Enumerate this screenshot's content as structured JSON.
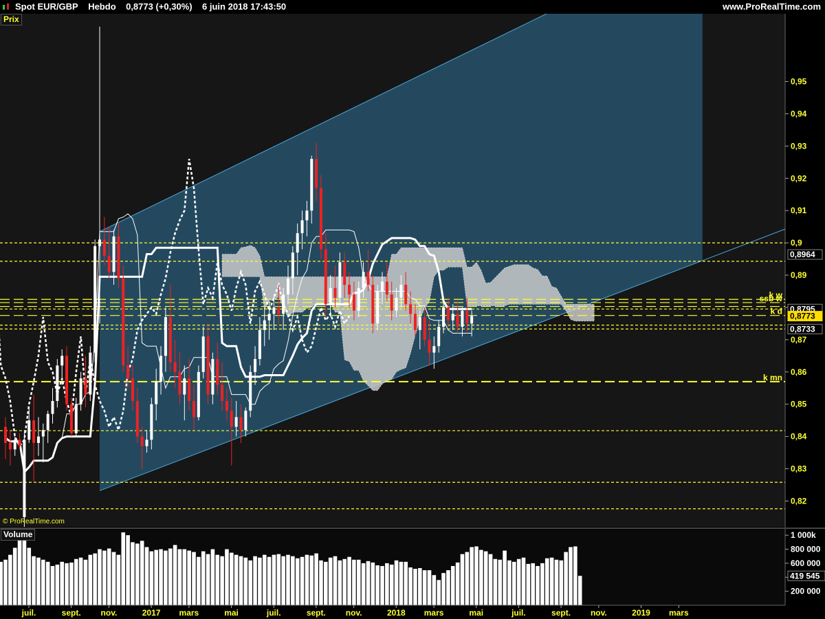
{
  "header": {
    "instrument": "Spot EUR/GBP",
    "period": "Hebdo",
    "last": "0,8773 (+0,30%)",
    "datetime": "6 juin 2018 17:43:50",
    "site": "www.ProRealTime.com"
  },
  "panels": {
    "price_label": "Prix",
    "volume_label": "Volume",
    "watermark": "© ProRealTime.com"
  },
  "colors": {
    "background": "#000000",
    "plot_bg": "#161616",
    "channel_fill": "#2a5b78",
    "channel_line": "#4aa8d8",
    "bull": "#ffffff",
    "bear": "#ee2222",
    "level_line": "#ffff33",
    "cloud": "#d0d0d0",
    "tick_text": "#ffff33"
  },
  "chart_data": {
    "type": "candlestick",
    "title": "Spot EUR/GBP",
    "y_axis": {
      "ylim": [
        0.812,
        0.971
      ],
      "ticks": [
        0.82,
        0.83,
        0.84,
        0.85,
        0.86,
        0.87,
        0.88,
        0.89,
        0.9,
        0.91,
        0.92,
        0.93,
        0.94,
        0.95
      ],
      "tick_labels": [
        "0,82",
        "0,83",
        "0,84",
        "0,85",
        "0,86",
        "0,87",
        "0,88",
        "0,89",
        "0,9",
        "0,91",
        "0,92",
        "0,93",
        "0,94",
        "0,95"
      ]
    },
    "x_axis": {
      "labels": [
        "juil.",
        "sept.",
        "nov.",
        "2017",
        "mars",
        "mai",
        "juil.",
        "sept.",
        "nov.",
        "2018",
        "mars",
        "mai",
        "juil.",
        "sept.",
        "nov.",
        "2019",
        "mars"
      ],
      "label_weeks": [
        0,
        9,
        17,
        26,
        34,
        43,
        52,
        61,
        69,
        78,
        86,
        95,
        104,
        113,
        121,
        130,
        138
      ]
    },
    "price_tags": [
      {
        "label": "0,8964",
        "value": 0.8964,
        "highlight": false
      },
      {
        "label": "0,8795",
        "value": 0.8795,
        "highlight": false
      },
      {
        "label": "0,8773",
        "value": 0.8773,
        "highlight": true
      },
      {
        "label": "0,8733",
        "value": 0.8733,
        "highlight": false
      }
    ],
    "levels": [
      {
        "value": 0.9,
        "name": "",
        "style": "dotted"
      },
      {
        "value": 0.8943,
        "name": "",
        "style": "dotted"
      },
      {
        "value": 0.8825,
        "name": "k w",
        "style": "dashed"
      },
      {
        "value": 0.8815,
        "name": "ssb w",
        "style": "dashed"
      },
      {
        "value": 0.8803,
        "name": "",
        "style": "dashed"
      },
      {
        "value": 0.8795,
        "name": "",
        "style": "dotted"
      },
      {
        "value": 0.8775,
        "name": "k d",
        "style": "dashed"
      },
      {
        "value": 0.8745,
        "name": "",
        "style": "dotted"
      },
      {
        "value": 0.8733,
        "name": "",
        "style": "dotted"
      },
      {
        "value": 0.857,
        "name": "k mn",
        "style": "dashed"
      },
      {
        "value": 0.8418,
        "name": "",
        "style": "dotted"
      },
      {
        "value": 0.8258,
        "name": "",
        "style": "dotted"
      },
      {
        "value": 0.8176,
        "name": "",
        "style": "dotted"
      }
    ],
    "channel": {
      "upper": [
        [
          20,
          0.9035
        ],
        [
          124,
          0.9775
        ]
      ],
      "lower": [
        [
          20,
          0.8232
        ],
        [
          148,
          0.8945
        ]
      ],
      "end_week": 148
    },
    "candles": [
      {
        "o": 0.843,
        "h": 0.846,
        "l": 0.833,
        "c": 0.838
      },
      {
        "o": 0.838,
        "h": 0.842,
        "l": 0.831,
        "c": 0.836
      },
      {
        "o": 0.836,
        "h": 0.84,
        "l": 0.834,
        "c": 0.839
      },
      {
        "o": 0.839,
        "h": 0.841,
        "l": 0.836,
        "c": 0.837
      },
      {
        "o": 0.815,
        "h": 0.842,
        "l": 0.812,
        "c": 0.839
      },
      {
        "o": 0.839,
        "h": 0.849,
        "l": 0.838,
        "c": 0.845
      },
      {
        "o": 0.845,
        "h": 0.853,
        "l": 0.826,
        "c": 0.838
      },
      {
        "o": 0.838,
        "h": 0.846,
        "l": 0.834,
        "c": 0.84
      },
      {
        "o": 0.84,
        "h": 0.844,
        "l": 0.832,
        "c": 0.842
      },
      {
        "o": 0.842,
        "h": 0.848,
        "l": 0.838,
        "c": 0.847
      },
      {
        "o": 0.847,
        "h": 0.855,
        "l": 0.844,
        "c": 0.851
      },
      {
        "o": 0.851,
        "h": 0.864,
        "l": 0.849,
        "c": 0.862
      },
      {
        "o": 0.862,
        "h": 0.867,
        "l": 0.856,
        "c": 0.865
      },
      {
        "o": 0.865,
        "h": 0.868,
        "l": 0.848,
        "c": 0.85
      },
      {
        "o": 0.85,
        "h": 0.852,
        "l": 0.84,
        "c": 0.841
      },
      {
        "o": 0.841,
        "h": 0.852,
        "l": 0.84,
        "c": 0.85
      },
      {
        "o": 0.85,
        "h": 0.86,
        "l": 0.848,
        "c": 0.858
      },
      {
        "o": 0.858,
        "h": 0.865,
        "l": 0.849,
        "c": 0.853
      },
      {
        "o": 0.853,
        "h": 0.868,
        "l": 0.851,
        "c": 0.866
      },
      {
        "o": 0.866,
        "h": 0.901,
        "l": 0.863,
        "c": 0.899
      },
      {
        "o": 0.899,
        "h": 0.967,
        "l": 0.875,
        "c": 0.901
      },
      {
        "o": 0.901,
        "h": 0.908,
        "l": 0.893,
        "c": 0.896
      },
      {
        "o": 0.896,
        "h": 0.905,
        "l": 0.889,
        "c": 0.891
      },
      {
        "o": 0.891,
        "h": 0.904,
        "l": 0.887,
        "c": 0.902
      },
      {
        "o": 0.902,
        "h": 0.906,
        "l": 0.886,
        "c": 0.889
      },
      {
        "o": 0.889,
        "h": 0.893,
        "l": 0.86,
        "c": 0.862
      },
      {
        "o": 0.862,
        "h": 0.868,
        "l": 0.855,
        "c": 0.858
      },
      {
        "o": 0.858,
        "h": 0.862,
        "l": 0.848,
        "c": 0.851
      },
      {
        "o": 0.851,
        "h": 0.855,
        "l": 0.838,
        "c": 0.84
      },
      {
        "o": 0.84,
        "h": 0.843,
        "l": 0.83,
        "c": 0.837
      },
      {
        "o": 0.837,
        "h": 0.842,
        "l": 0.835,
        "c": 0.839
      },
      {
        "o": 0.839,
        "h": 0.852,
        "l": 0.836,
        "c": 0.85
      },
      {
        "o": 0.85,
        "h": 0.861,
        "l": 0.845,
        "c": 0.857
      },
      {
        "o": 0.857,
        "h": 0.868,
        "l": 0.853,
        "c": 0.865
      },
      {
        "o": 0.865,
        "h": 0.88,
        "l": 0.86,
        "c": 0.877
      },
      {
        "o": 0.877,
        "h": 0.887,
        "l": 0.86,
        "c": 0.863
      },
      {
        "o": 0.863,
        "h": 0.87,
        "l": 0.855,
        "c": 0.86
      },
      {
        "o": 0.86,
        "h": 0.866,
        "l": 0.85,
        "c": 0.853
      },
      {
        "o": 0.853,
        "h": 0.862,
        "l": 0.845,
        "c": 0.858
      },
      {
        "o": 0.858,
        "h": 0.864,
        "l": 0.848,
        "c": 0.851
      },
      {
        "o": 0.851,
        "h": 0.856,
        "l": 0.842,
        "c": 0.846
      },
      {
        "o": 0.846,
        "h": 0.862,
        "l": 0.845,
        "c": 0.86
      },
      {
        "o": 0.86,
        "h": 0.874,
        "l": 0.858,
        "c": 0.871
      },
      {
        "o": 0.871,
        "h": 0.875,
        "l": 0.85,
        "c": 0.853
      },
      {
        "o": 0.853,
        "h": 0.866,
        "l": 0.85,
        "c": 0.864
      },
      {
        "o": 0.864,
        "h": 0.869,
        "l": 0.853,
        "c": 0.856
      },
      {
        "o": 0.856,
        "h": 0.863,
        "l": 0.848,
        "c": 0.851
      },
      {
        "o": 0.851,
        "h": 0.855,
        "l": 0.845,
        "c": 0.848
      },
      {
        "o": 0.848,
        "h": 0.852,
        "l": 0.831,
        "c": 0.843
      },
      {
        "o": 0.843,
        "h": 0.851,
        "l": 0.84,
        "c": 0.846
      },
      {
        "o": 0.846,
        "h": 0.85,
        "l": 0.838,
        "c": 0.842
      },
      {
        "o": 0.842,
        "h": 0.849,
        "l": 0.84,
        "c": 0.848
      },
      {
        "o": 0.848,
        "h": 0.862,
        "l": 0.846,
        "c": 0.86
      },
      {
        "o": 0.86,
        "h": 0.868,
        "l": 0.856,
        "c": 0.864
      },
      {
        "o": 0.864,
        "h": 0.877,
        "l": 0.862,
        "c": 0.873
      },
      {
        "o": 0.873,
        "h": 0.88,
        "l": 0.868,
        "c": 0.876
      },
      {
        "o": 0.876,
        "h": 0.882,
        "l": 0.87,
        "c": 0.878
      },
      {
        "o": 0.878,
        "h": 0.884,
        "l": 0.873,
        "c": 0.88
      },
      {
        "o": 0.88,
        "h": 0.887,
        "l": 0.875,
        "c": 0.878
      },
      {
        "o": 0.878,
        "h": 0.886,
        "l": 0.873,
        "c": 0.884
      },
      {
        "o": 0.884,
        "h": 0.893,
        "l": 0.881,
        "c": 0.889
      },
      {
        "o": 0.889,
        "h": 0.899,
        "l": 0.884,
        "c": 0.897
      },
      {
        "o": 0.897,
        "h": 0.906,
        "l": 0.89,
        "c": 0.903
      },
      {
        "o": 0.903,
        "h": 0.91,
        "l": 0.898,
        "c": 0.907
      },
      {
        "o": 0.907,
        "h": 0.913,
        "l": 0.902,
        "c": 0.91
      },
      {
        "o": 0.91,
        "h": 0.927,
        "l": 0.906,
        "c": 0.926
      },
      {
        "o": 0.926,
        "h": 0.931,
        "l": 0.913,
        "c": 0.917
      },
      {
        "o": 0.917,
        "h": 0.921,
        "l": 0.895,
        "c": 0.898
      },
      {
        "o": 0.898,
        "h": 0.903,
        "l": 0.877,
        "c": 0.881
      },
      {
        "o": 0.881,
        "h": 0.89,
        "l": 0.877,
        "c": 0.886
      },
      {
        "o": 0.886,
        "h": 0.893,
        "l": 0.88,
        "c": 0.883
      },
      {
        "o": 0.883,
        "h": 0.897,
        "l": 0.881,
        "c": 0.894
      },
      {
        "o": 0.894,
        "h": 0.897,
        "l": 0.883,
        "c": 0.887
      },
      {
        "o": 0.887,
        "h": 0.891,
        "l": 0.88,
        "c": 0.884
      },
      {
        "o": 0.884,
        "h": 0.888,
        "l": 0.876,
        "c": 0.879
      },
      {
        "o": 0.879,
        "h": 0.888,
        "l": 0.877,
        "c": 0.886
      },
      {
        "o": 0.886,
        "h": 0.894,
        "l": 0.883,
        "c": 0.891
      },
      {
        "o": 0.891,
        "h": 0.898,
        "l": 0.885,
        "c": 0.887
      },
      {
        "o": 0.887,
        "h": 0.89,
        "l": 0.872,
        "c": 0.875
      },
      {
        "o": 0.875,
        "h": 0.887,
        "l": 0.873,
        "c": 0.885
      },
      {
        "o": 0.885,
        "h": 0.891,
        "l": 0.881,
        "c": 0.888
      },
      {
        "o": 0.888,
        "h": 0.894,
        "l": 0.882,
        "c": 0.884
      },
      {
        "o": 0.884,
        "h": 0.888,
        "l": 0.876,
        "c": 0.879
      },
      {
        "o": 0.879,
        "h": 0.886,
        "l": 0.877,
        "c": 0.883
      },
      {
        "o": 0.883,
        "h": 0.89,
        "l": 0.88,
        "c": 0.887
      },
      {
        "o": 0.887,
        "h": 0.891,
        "l": 0.879,
        "c": 0.881
      },
      {
        "o": 0.881,
        "h": 0.885,
        "l": 0.875,
        "c": 0.878
      },
      {
        "o": 0.878,
        "h": 0.881,
        "l": 0.871,
        "c": 0.873
      },
      {
        "o": 0.873,
        "h": 0.879,
        "l": 0.867,
        "c": 0.877
      },
      {
        "o": 0.877,
        "h": 0.88,
        "l": 0.868,
        "c": 0.87
      },
      {
        "o": 0.87,
        "h": 0.876,
        "l": 0.862,
        "c": 0.866
      },
      {
        "o": 0.866,
        "h": 0.871,
        "l": 0.861,
        "c": 0.868
      },
      {
        "o": 0.868,
        "h": 0.876,
        "l": 0.866,
        "c": 0.874
      },
      {
        "o": 0.874,
        "h": 0.882,
        "l": 0.872,
        "c": 0.88
      },
      {
        "o": 0.88,
        "h": 0.883,
        "l": 0.874,
        "c": 0.876
      },
      {
        "o": 0.876,
        "h": 0.881,
        "l": 0.873,
        "c": 0.878
      },
      {
        "o": 0.878,
        "h": 0.882,
        "l": 0.872,
        "c": 0.874
      },
      {
        "o": 0.874,
        "h": 0.88,
        "l": 0.871,
        "c": 0.879
      },
      {
        "o": 0.879,
        "h": 0.883,
        "l": 0.872,
        "c": 0.875
      },
      {
        "o": 0.875,
        "h": 0.879,
        "l": 0.871,
        "c": 0.8773
      }
    ],
    "volume": {
      "ticks": [
        200000,
        400000,
        600000,
        800000,
        1000000
      ],
      "tick_labels": [
        "200 000",
        "400 000",
        "600 000",
        "800 000",
        "1 000k"
      ],
      "last_label": "419 545",
      "last_value": 419545,
      "ylim": [
        0,
        1080000
      ],
      "values": [
        620000,
        650000,
        720000,
        820000,
        1050000,
        1000000,
        820000,
        700000,
        680000,
        650000,
        620000,
        560000,
        580000,
        620000,
        600000,
        610000,
        660000,
        680000,
        650000,
        720000,
        740000,
        800000,
        780000,
        810000,
        760000,
        720000,
        1040000,
        1000000,
        900000,
        880000,
        920000,
        830000,
        770000,
        790000,
        800000,
        780000,
        810000,
        860000,
        800000,
        800000,
        780000,
        760000,
        690000,
        770000,
        730000,
        800000,
        720000,
        700000,
        800000,
        750000,
        720000,
        700000,
        680000,
        640000,
        700000,
        680000,
        720000,
        690000,
        720000,
        730000,
        700000,
        720000,
        700000,
        670000,
        690000,
        720000,
        710000,
        740000,
        640000,
        620000,
        680000,
        700000,
        640000,
        660000,
        690000,
        650000,
        650000,
        600000,
        630000,
        610000,
        570000,
        560000,
        600000,
        580000,
        640000,
        620000,
        620000,
        540000,
        520000,
        530000,
        500000,
        500000,
        430000,
        360000,
        460000,
        500000,
        560000,
        610000,
        730000,
        760000,
        830000,
        840000,
        790000,
        770000,
        730000,
        660000,
        650000,
        780000,
        640000,
        620000,
        660000,
        680000,
        590000,
        600000,
        560000,
        600000,
        670000,
        680000,
        650000,
        640000,
        760000,
        830000,
        840000,
        419545
      ]
    }
  }
}
